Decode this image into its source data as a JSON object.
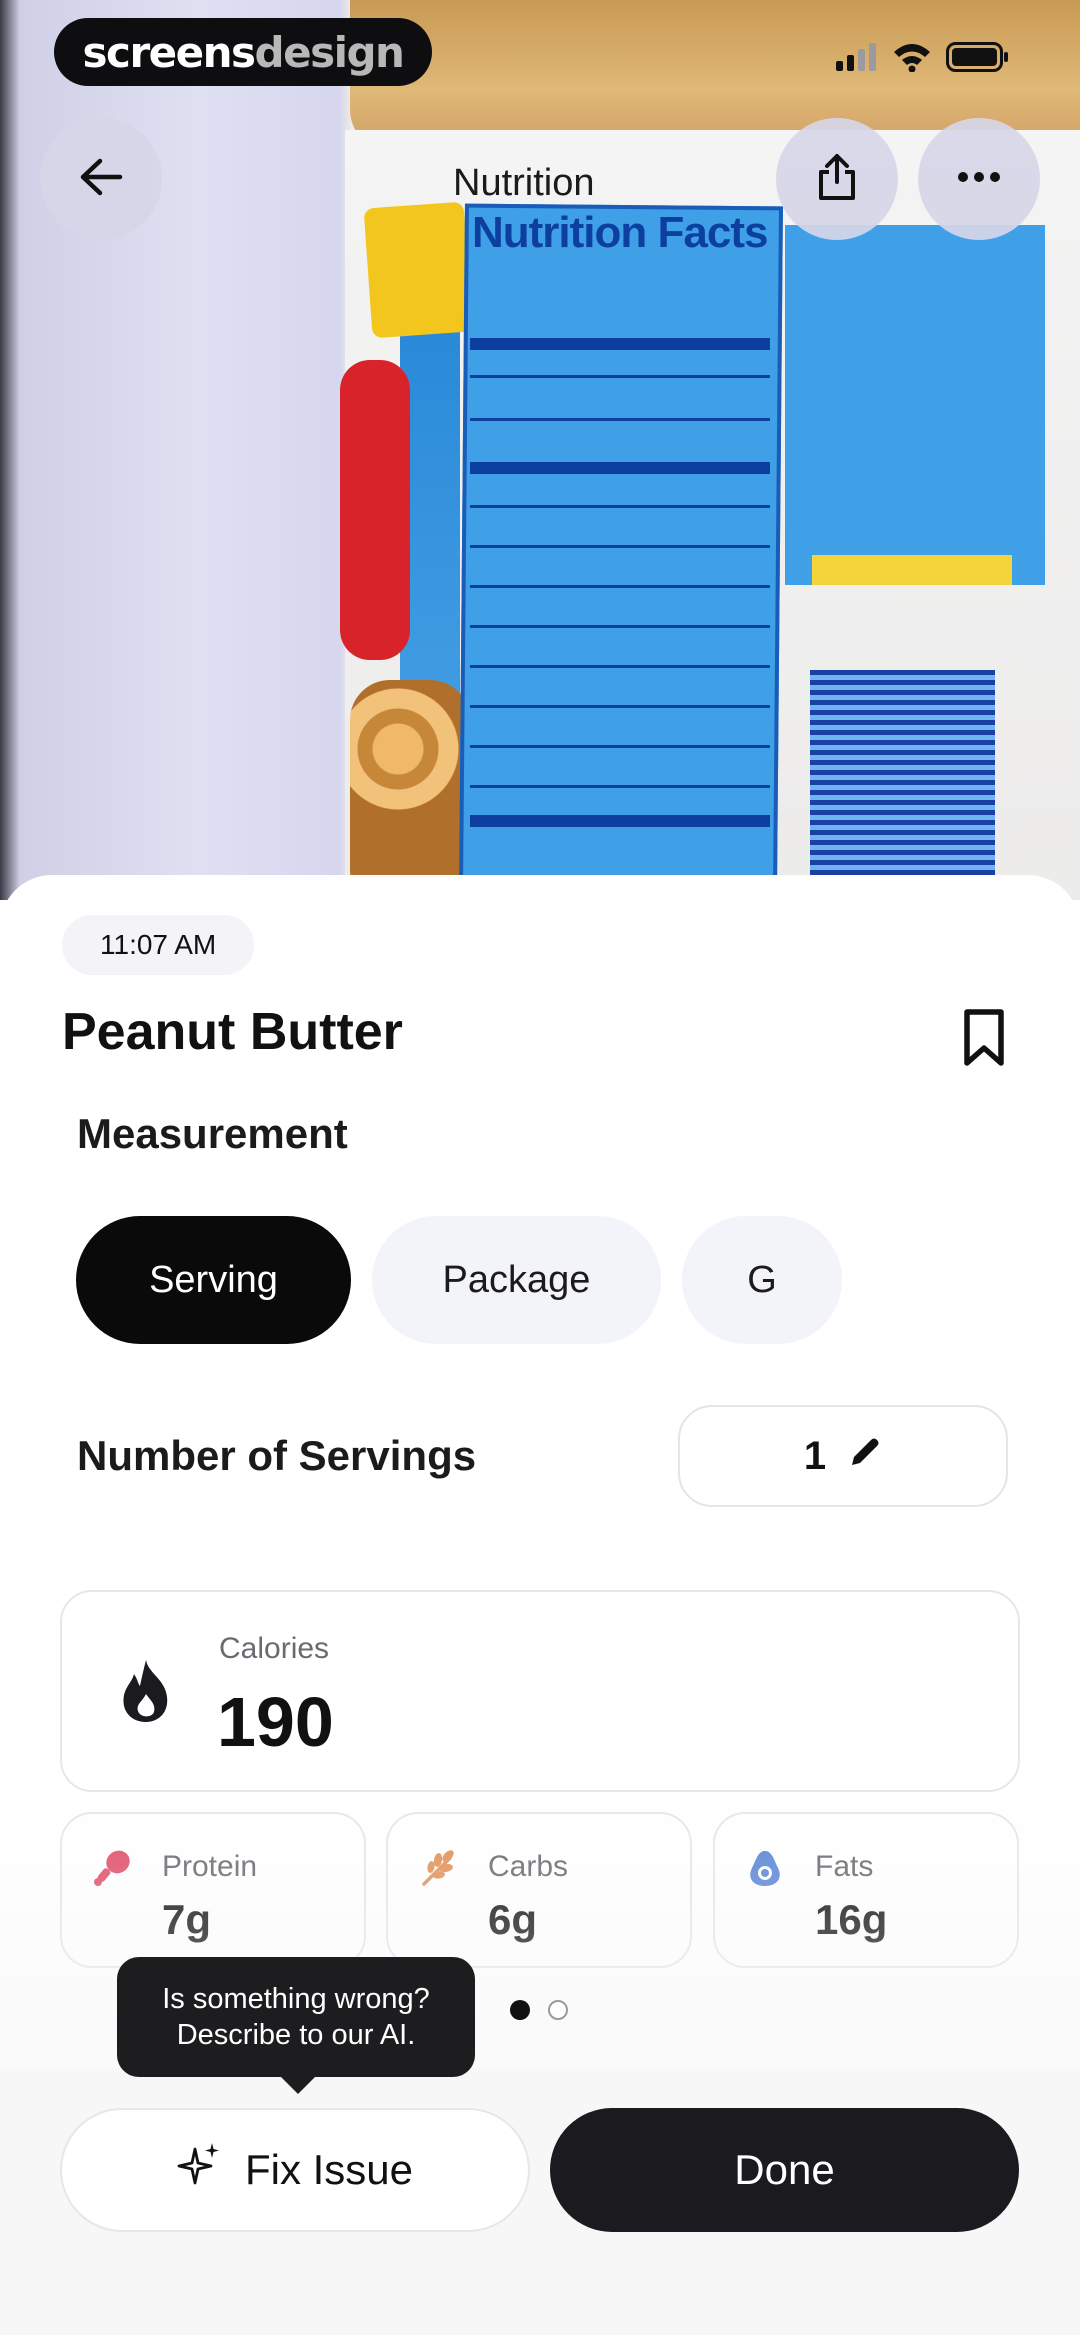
{
  "watermark": {
    "part1": "screens",
    "part2": "design"
  },
  "status_bar": {
    "signal": "signal-icon",
    "wifi": "wifi-icon",
    "battery": "battery-icon"
  },
  "header": {
    "title": "Nutrition",
    "back_icon": "back-arrow-icon",
    "share_icon": "share-icon",
    "more_icon": "more-icon"
  },
  "photo": {
    "label_title": "Nutrition Facts"
  },
  "entry": {
    "time": "11:07 AM",
    "name": "Peanut Butter",
    "bookmark_icon": "bookmark-icon"
  },
  "measurement": {
    "label": "Measurement",
    "options": [
      {
        "label": "Serving",
        "selected": true
      },
      {
        "label": "Package",
        "selected": false
      },
      {
        "label": "G",
        "selected": false
      }
    ]
  },
  "servings": {
    "label": "Number of Servings",
    "value": "1",
    "edit_icon": "pencil-icon"
  },
  "calories": {
    "label": "Calories",
    "value": "190",
    "icon": "flame-icon"
  },
  "macros": [
    {
      "label": "Protein",
      "value": "7g",
      "icon": "drumstick-icon",
      "color": "#e0506a"
    },
    {
      "label": "Carbs",
      "value": "6g",
      "icon": "wheat-icon",
      "color": "#e2925a"
    },
    {
      "label": "Fats",
      "value": "16g",
      "icon": "avocado-icon",
      "color": "#5a86d6"
    }
  ],
  "pager": {
    "pages": 2,
    "current": 1
  },
  "tooltip": {
    "line1": "Is something wrong?",
    "line2": "Describe to our AI."
  },
  "actions": {
    "fix_label": "Fix Issue",
    "fix_icon": "sparkle-icon",
    "done_label": "Done"
  }
}
